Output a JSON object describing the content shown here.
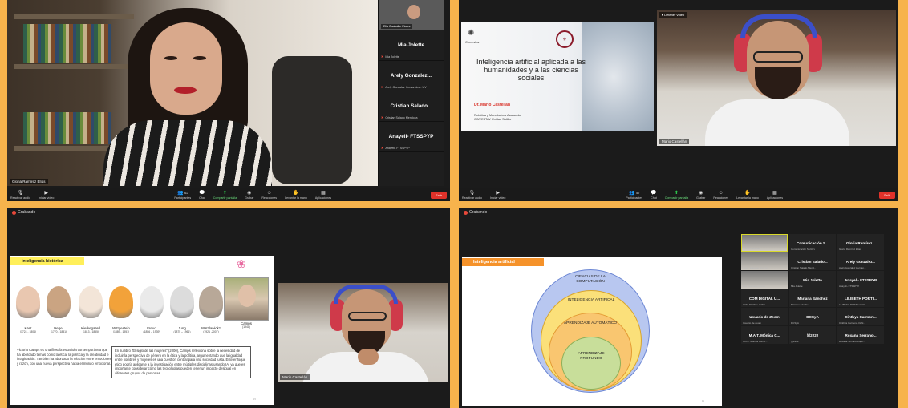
{
  "recording_label": "Grabando",
  "toolbar": {
    "audio": "Reactivar audio",
    "video": "Iniciar vídeo",
    "participants": "Participantes",
    "participants_count_p1": "62",
    "participants_count_p2": "57",
    "chat": "Chat",
    "share": "Compartir pantalla",
    "record": "Grabar",
    "reactions": "Reacciones",
    "apps_more": "Levantar la mano",
    "apps": "Aplicaciones",
    "end": "Salir"
  },
  "panel1": {
    "speaker_name": "Gloria Ramírez Elías",
    "gallery": [
      {
        "big": "",
        "small": "Elia Cuahuihe Flores",
        "video": true
      },
      {
        "big": "Mia Jolette",
        "small": "Mia Jolette"
      },
      {
        "big": "Arely Gonzalez...",
        "small": "Arely Gonzalez Hernandez - UV"
      },
      {
        "big": "Cristian Salado...",
        "small": "Cristian Salado Mendoza"
      },
      {
        "big": "Anayeli- FTSSPYP",
        "small": "Anayeli- FTSSPYP"
      }
    ]
  },
  "panel2": {
    "stop_share": "Detener vídeo",
    "slide_logo_left": "Cinvestav",
    "slide_title": "Inteligencia artificial aplicada a las humanidades y a las ciencias sociales",
    "slide_author": "Dr. Mario Castellán",
    "slide_inst_1": "Robótica y Manufactura Avanzada",
    "slide_inst_2": "CINVESTAV Unidad Saltillo",
    "cam_name": "Mario Castellán"
  },
  "panel3": {
    "slide_header": "Inteligencia histórica",
    "philosophers": [
      {
        "name": "Kant",
        "years": "(1724 - 1804)",
        "color": "#e9c7b0"
      },
      {
        "name": "Hegel",
        "years": "(1770 - 1831)",
        "color": "#caa482"
      },
      {
        "name": "Kierkegaard",
        "years": "(1813 - 1855)",
        "color": "#f3e5d8"
      },
      {
        "name": "Wittgestein",
        "years": "(1889 - 1951)",
        "color": "#f2a23a"
      },
      {
        "name": "Freud",
        "years": "(1856 – 1939)",
        "color": "#eaeaea"
      },
      {
        "name": "Jung",
        "years": "(1875 – 1961)",
        "color": "#dcdcdc"
      },
      {
        "name": "Watzlawickz",
        "years": "(1921 -2007)",
        "color": "#b8a898"
      },
      {
        "name": "Camps",
        "years": "(1941)",
        "color": "#d9c7b0"
      }
    ],
    "text_left": "Victoria Camps es una filósofa española contemporánea que ha abordado temas como la ética, la política y la creatividad e imaginación. También ha abordado la relación entre emociones y razón, con una nueva perspectiva hacia el mundo emocional.",
    "text_box": "En su libro \"El siglo de las mujeres\" (2000), Camps reflexiona sobre la necesidad de incluir la perspectiva de género en la ética y la política, argumentando que la igualdad entre hombres y mujeres es una cuestión central para una sociedad justa. Este enfoque ético podría aplicarse a la investigación entre múltiples disciplinas usando IA, ya que es importante considerar cómo las tecnologías pueden tener un impacto desigual en diferentes grupos de personas.",
    "page_num": "15",
    "cam_name": "Mario Castellán"
  },
  "panel4": {
    "slide_header": "Inteligencia artificial",
    "rings": [
      "CIENCIAS DE LA COMPUTACIÓN",
      "INTELIGENCIA ARTIFICAL",
      "APRENDIZAJE AUTOMÁTICO",
      "APRENDIZAJE PROFUNDO"
    ],
    "page_num": "11",
    "grid": [
      {
        "big": "",
        "small": "Mario Castellán",
        "video": true,
        "active": true
      },
      {
        "big": "Comunicación S...",
        "small": "Comunicación S.UATx"
      },
      {
        "big": "Gloria Ramírez...",
        "small": "Gloria Ramírez Elías"
      },
      {
        "big": "",
        "small": "Inves. Eduardo Cruz G...",
        "video": true
      },
      {
        "big": "Cristian Salado...",
        "small": "Cristian Salado Mend..."
      },
      {
        "big": "Arely Gonzalez...",
        "small": "Arely Gonzalez Hernan..."
      },
      {
        "big": "",
        "small": "Elia Cuahuihe Flores",
        "video": true
      },
      {
        "big": "Mia Jolette",
        "small": "Mia Jolette"
      },
      {
        "big": "Anayeli- FTSSPYP",
        "small": "Anayeli- FTSSPYP"
      },
      {
        "big": "COM DIGITAL U...",
        "small": "COM DIGITAL UATX"
      },
      {
        "big": "Mariana Sánchez",
        "small": "Mariana Sánchez"
      },
      {
        "big": "LILIBETH PORTI...",
        "small": "LILIBETH PORTILLO R..."
      },
      {
        "big": "Usuario de Zoom",
        "small": "Usuario de Zoom"
      },
      {
        "big": "DCSyA",
        "small": "DCSyA"
      },
      {
        "big": "Cinthya Carmon...",
        "small": "Cinthya Carmona Ochi..."
      },
      {
        "big": "M.A.T. Mónica C...",
        "small": "M.A.T. Mónica Corral..."
      },
      {
        "big": "(((2222",
        "small": "(((2222"
      },
      {
        "big": "Roxana Serrano...",
        "small": "Roxana Serrano Ruge..."
      }
    ]
  }
}
